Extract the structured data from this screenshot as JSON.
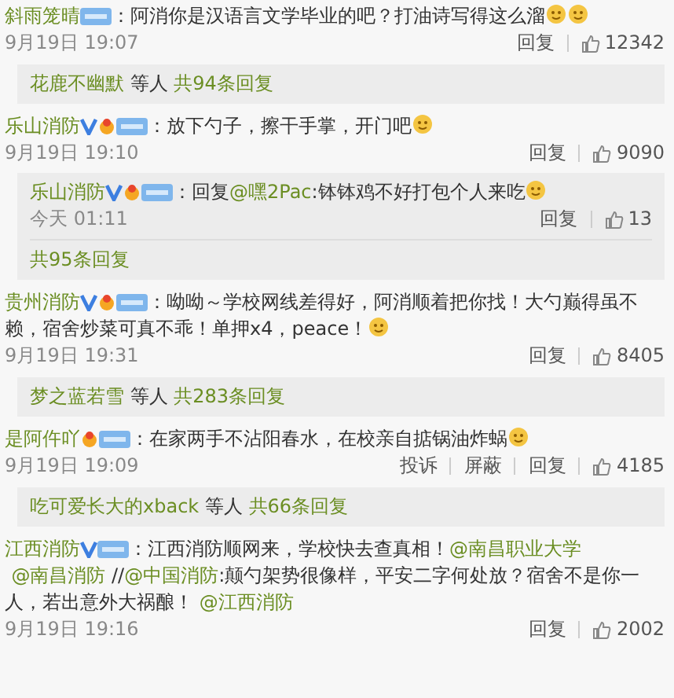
{
  "comments": [
    {
      "user": "斜雨笼晴",
      "verified": false,
      "fan_badge": false,
      "level_badge": true,
      "parts": [
        {
          "kind": "text",
          "text": "：阿消你是汉语言文学毕业的吧？打油诗写得这么溜"
        },
        {
          "kind": "emoji"
        },
        {
          "kind": "emoji"
        }
      ],
      "time": "9月19日 19:07",
      "actions": [
        "回复"
      ],
      "likes": "12342",
      "replies": {
        "kind": "summary",
        "names": "花鹿不幽默",
        "others": "等人",
        "total": "共94条回复"
      }
    },
    {
      "user": "乐山消防",
      "verified": true,
      "fan_badge": true,
      "level_badge": true,
      "parts": [
        {
          "kind": "text",
          "text": "：放下勺子，擦干手掌，开门吧"
        },
        {
          "kind": "emoji"
        }
      ],
      "time": "9月19日 19:10",
      "actions": [
        "回复"
      ],
      "likes": "9090",
      "replies": {
        "kind": "thread",
        "items": [
          {
            "user": "乐山消防",
            "verified": true,
            "fan_badge": true,
            "level_badge": true,
            "parts": [
              {
                "kind": "text",
                "text": "：回复"
              },
              {
                "kind": "link",
                "text": "@嘿2Pac"
              },
              {
                "kind": "text",
                "text": ":钵钵鸡不好打包个人来吃"
              },
              {
                "kind": "emoji"
              }
            ],
            "time": "今天 01:11",
            "actions": [
              "回复"
            ],
            "likes": "13"
          }
        ],
        "total": "共95条回复"
      }
    },
    {
      "user": "贵州消防",
      "verified": true,
      "fan_badge": true,
      "level_badge": true,
      "parts": [
        {
          "kind": "text",
          "text": "：呦呦～学校网线差得好，阿消顺着把你找！大勺巅得虽不赖，宿舍炒菜可真不乖！单押x4，peace！"
        },
        {
          "kind": "emoji"
        }
      ],
      "time": "9月19日 19:31",
      "actions": [
        "回复"
      ],
      "likes": "8405",
      "replies": {
        "kind": "summary",
        "names": "梦之蓝若雪",
        "others": "等人",
        "total": "共283条回复"
      }
    },
    {
      "user": "是阿仵吖",
      "verified": false,
      "fan_badge": true,
      "level_badge": true,
      "parts": [
        {
          "kind": "text",
          "text": "：在家两手不沾阳春水，在校亲自掂锅油炸蜗"
        },
        {
          "kind": "emoji"
        }
      ],
      "time": "9月19日 19:09",
      "actions": [
        "投诉",
        "屏蔽",
        "回复"
      ],
      "likes": "4185",
      "replies": {
        "kind": "summary",
        "names": "吃可爱长大的xback",
        "others": "等人",
        "total": "共66条回复"
      }
    },
    {
      "user": "江西消防",
      "verified": true,
      "fan_badge": false,
      "level_badge": true,
      "parts": [
        {
          "kind": "text",
          "text": "：江西消防顺网来，学校快去查真相！"
        },
        {
          "kind": "link",
          "text": "@南昌职业大学"
        },
        {
          "kind": "link",
          "text": "@南昌消防"
        },
        {
          "kind": "text",
          "text": " //"
        },
        {
          "kind": "link",
          "text": "@中国消防"
        },
        {
          "kind": "text",
          "text": ":颠勺架势很像样，平安二字何处放？宿舍不是你一人，若出意外大祸酿！ "
        },
        {
          "kind": "link",
          "text": "@江西消防"
        }
      ],
      "time": "9月19日 19:16",
      "actions": [
        "回复"
      ],
      "likes": "2002"
    }
  ]
}
